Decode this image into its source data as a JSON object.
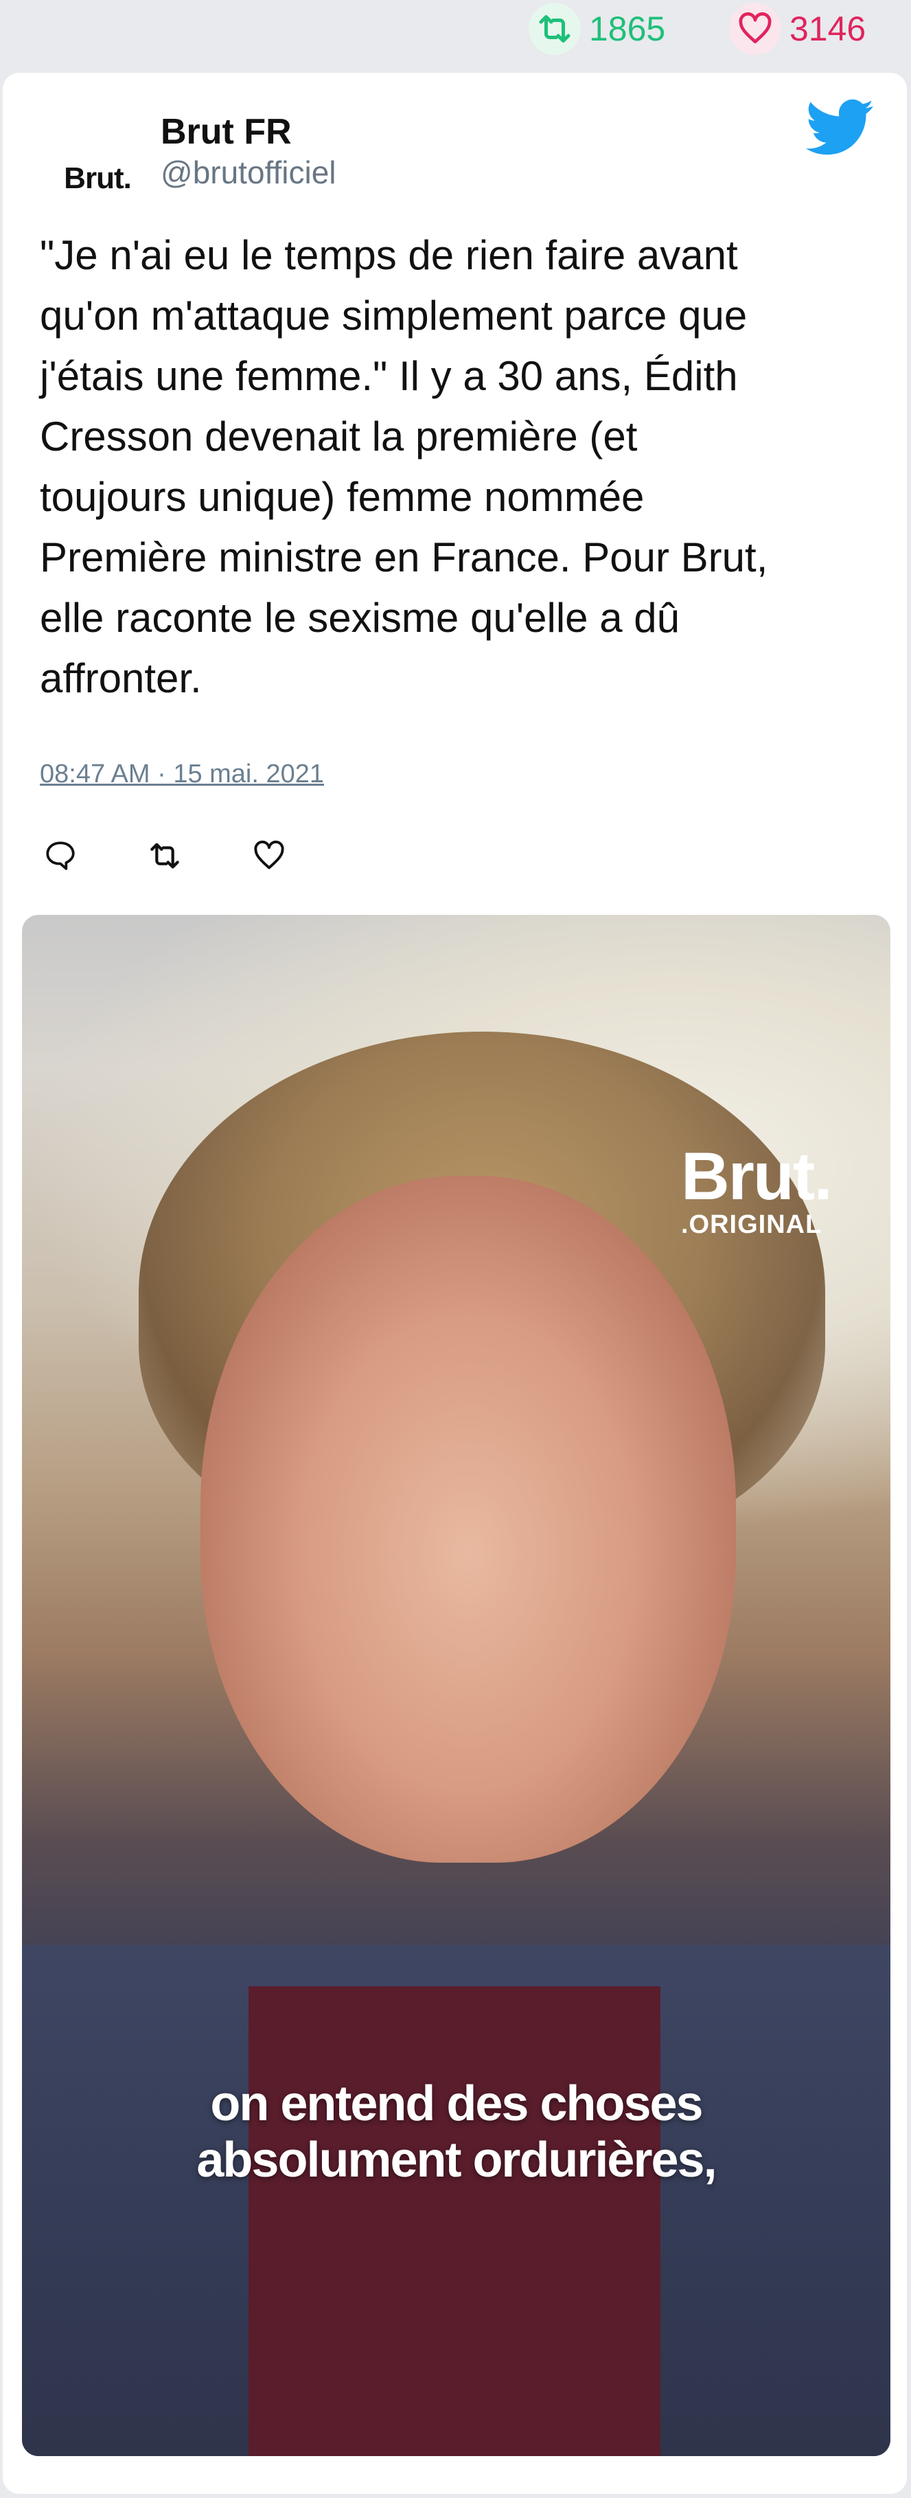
{
  "stats": {
    "retweets": "1865",
    "likes": "3146",
    "retweet_color": "#1fbf7a",
    "like_color": "#e0245e"
  },
  "tweet": {
    "avatar_text": "Brut.",
    "display_name": "Brut FR",
    "handle": "@brutofficiel",
    "text_lines": [
      "\"Je n'ai eu le temps de rien faire avant",
      "qu'on m'attaque simplement parce que",
      "j'étais une femme.\" Il y a 30 ans, Édith",
      "Cresson devenait la première (et",
      "toujours unique) femme nommée",
      "Première ministre en France. Pour Brut,",
      "elle raconte le sexisme qu'elle a dû",
      "affronter."
    ],
    "timestamp": "08:47 AM · 15 mai. 2021",
    "accent_color": "#1da1f2"
  },
  "media": {
    "watermark_main": "Brut.",
    "watermark_sub": ".ORIGINAL",
    "caption_lines": [
      "on entend des choses",
      "absolument ordurières,"
    ]
  },
  "icons": {
    "retweet": "retweet-icon",
    "like": "heart-icon",
    "reply": "reply-icon",
    "brand": "twitter-bird-icon"
  }
}
